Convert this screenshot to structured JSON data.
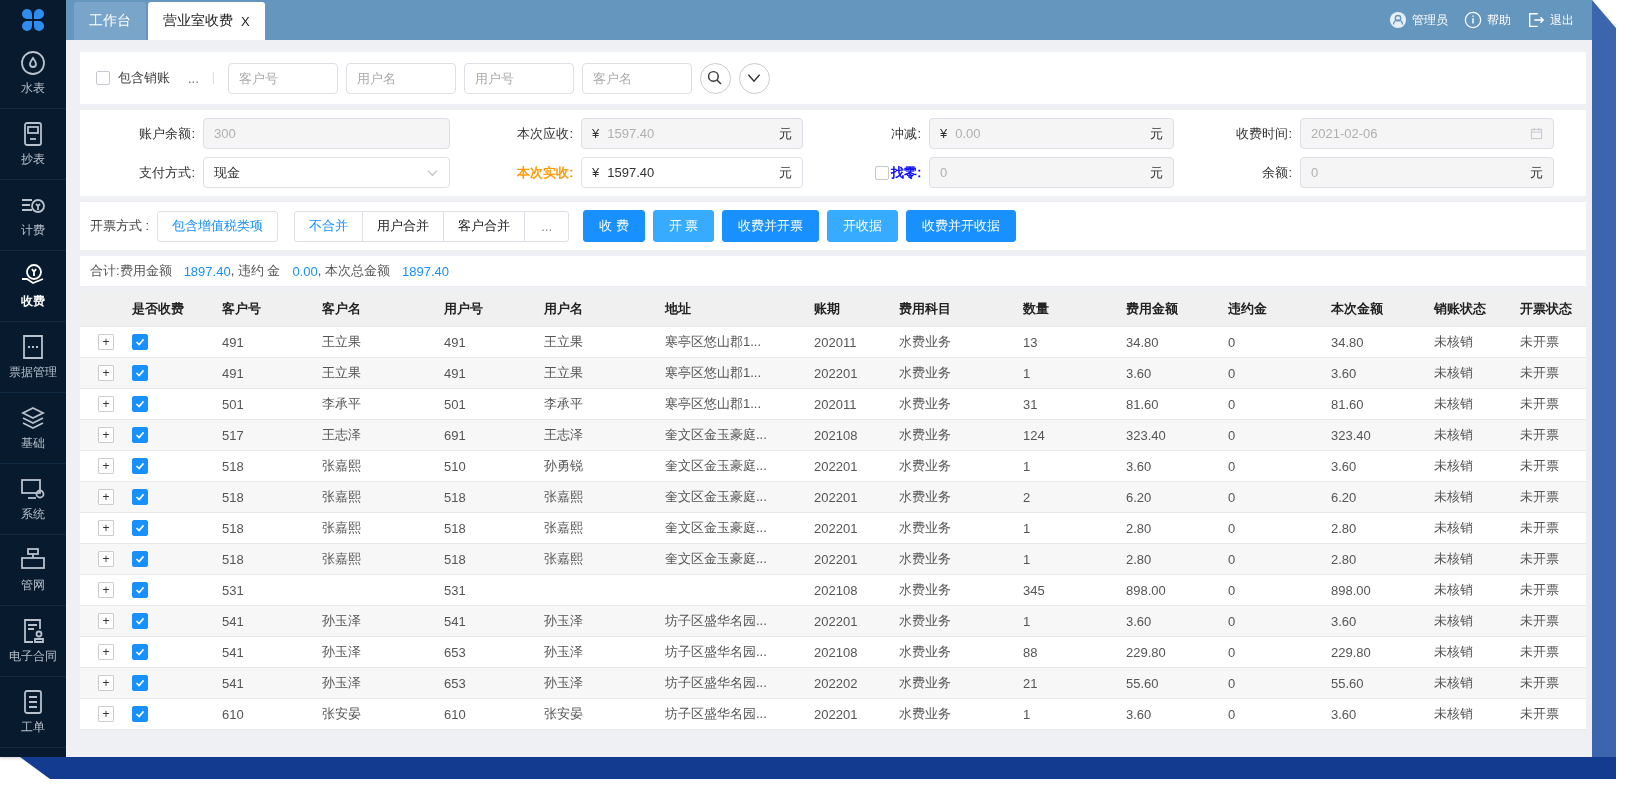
{
  "sidebar": {
    "items": [
      {
        "label": "水表",
        "selected": false
      },
      {
        "label": "抄表",
        "selected": false
      },
      {
        "label": "计费",
        "selected": false
      },
      {
        "label": "收费",
        "selected": true
      },
      {
        "label": "票据管理",
        "selected": false
      },
      {
        "label": "基础",
        "selected": false
      },
      {
        "label": "系统",
        "selected": false
      },
      {
        "label": "管网",
        "selected": false
      },
      {
        "label": "电子合同",
        "selected": false
      },
      {
        "label": "工单",
        "selected": false
      }
    ]
  },
  "tabs": [
    {
      "label": "工作台",
      "selected": false
    },
    {
      "label": "营业室收费",
      "selected": true,
      "close": "X"
    }
  ],
  "header_actions": [
    {
      "label": "管理员"
    },
    {
      "label": "帮助"
    },
    {
      "label": "退出"
    }
  ],
  "filter": {
    "include_writeoff": {
      "label": "包含销账",
      "checked": false
    },
    "more": "...",
    "fields": [
      {
        "placeholder": "客户号"
      },
      {
        "placeholder": "用户名"
      },
      {
        "placeholder": "用户号"
      },
      {
        "placeholder": "客户名"
      }
    ]
  },
  "form": [
    {
      "label": "账户余额:",
      "value": "300",
      "kind": "input",
      "disabled": true
    },
    {
      "label": "本次应收:",
      "value": "1597.40",
      "prefix": "¥",
      "suffix": "元",
      "kind": "input",
      "disabled": true
    },
    {
      "label": "冲减:",
      "value": "0.00",
      "prefix": "¥",
      "suffix": "元",
      "kind": "input",
      "disabled": true
    },
    {
      "label": "收费时间:",
      "value": "2021-02-06",
      "kind": "date",
      "disabled": true
    },
    {
      "label": "支付方式:",
      "value": "现金",
      "kind": "select",
      "disabled": false
    },
    {
      "label": "本次实收:",
      "value": "1597.40",
      "prefix": "¥",
      "suffix": "元",
      "kind": "input",
      "disabled": false,
      "color": "#ff9900"
    },
    {
      "label": "找零:",
      "value": "0",
      "suffix": "元",
      "kind": "input",
      "disabled": true,
      "color": "#0000ff",
      "checkbox": {
        "checked": false
      }
    },
    {
      "label": "余额:",
      "value": "0",
      "suffix": "元",
      "kind": "input",
      "disabled": true
    }
  ],
  "invoice": {
    "label": "开票方式 :",
    "option": "包含增值税类项",
    "merge": [
      {
        "label": "不合并",
        "selected": true
      },
      {
        "label": "用户合并",
        "selected": false
      },
      {
        "label": "客户合并",
        "selected": false
      },
      {
        "label": "...",
        "selected": false
      }
    ],
    "actions": [
      {
        "label": "收 费",
        "kind": "primary"
      },
      {
        "label": "开 票",
        "kind": "light"
      },
      {
        "label": "收费并开票",
        "kind": "primary"
      },
      {
        "label": "开收据",
        "kind": "light"
      },
      {
        "label": "收费并开收据",
        "kind": "primary"
      }
    ]
  },
  "summary": [
    {
      "label": "合计:费用金额",
      "value": "1897.40"
    },
    {
      "label": ", 违约 金",
      "value": "0.00"
    },
    {
      "label": ", 本次总金额",
      "value": "1897.40"
    }
  ],
  "table": {
    "check_column": "是否收费",
    "columns": [
      "客户号",
      "客户名",
      "用户号",
      "用户名",
      "地址",
      "账期",
      "费用科目",
      "数量",
      "费用金额",
      "违约金",
      "本次金额",
      "销账状态",
      "开票状态"
    ],
    "rows": [
      {
        "checked": true,
        "cells": [
          "491",
          "王立果",
          "491",
          "王立果",
          "寒亭区悠山郡1...",
          "202011",
          "水费业务",
          "13",
          "34.80",
          "0",
          "34.80",
          "未核销",
          "未开票"
        ]
      },
      {
        "checked": true,
        "cells": [
          "491",
          "王立果",
          "491",
          "王立果",
          "寒亭区悠山郡1...",
          "202201",
          "水费业务",
          "1",
          "3.60",
          "0",
          "3.60",
          "未核销",
          "未开票"
        ]
      },
      {
        "checked": true,
        "cells": [
          "501",
          "李承平",
          "501",
          "李承平",
          "寒亭区悠山郡1...",
          "202011",
          "水费业务",
          "31",
          "81.60",
          "0",
          "81.60",
          "未核销",
          "未开票"
        ]
      },
      {
        "checked": true,
        "cells": [
          "517",
          "王志泽",
          "691",
          "王志泽",
          "奎文区金玉豪庭...",
          "202108",
          "水费业务",
          "124",
          "323.40",
          "0",
          "323.40",
          "未核销",
          "未开票"
        ]
      },
      {
        "checked": true,
        "cells": [
          "518",
          "张嘉熙",
          "510",
          "孙勇锐",
          "奎文区金玉豪庭...",
          "202201",
          "水费业务",
          "1",
          "3.60",
          "0",
          "3.60",
          "未核销",
          "未开票"
        ]
      },
      {
        "checked": true,
        "cells": [
          "518",
          "张嘉熙",
          "518",
          "张嘉熙",
          "奎文区金玉豪庭...",
          "202201",
          "水费业务",
          "2",
          "6.20",
          "0",
          "6.20",
          "未核销",
          "未开票"
        ]
      },
      {
        "checked": true,
        "cells": [
          "518",
          "张嘉熙",
          "518",
          "张嘉熙",
          "奎文区金玉豪庭...",
          "202201",
          "水费业务",
          "1",
          "2.80",
          "0",
          "2.80",
          "未核销",
          "未开票"
        ]
      },
      {
        "checked": true,
        "cells": [
          "518",
          "张嘉熙",
          "518",
          "张嘉熙",
          "奎文区金玉豪庭...",
          "202201",
          "水费业务",
          "1",
          "2.80",
          "0",
          "2.80",
          "未核销",
          "未开票"
        ]
      },
      {
        "checked": true,
        "cells": [
          "531",
          "",
          "531",
          "",
          "",
          "202108",
          "水费业务",
          "345",
          "898.00",
          "0",
          "898.00",
          "未核销",
          "未开票"
        ]
      },
      {
        "checked": true,
        "cells": [
          "541",
          "孙玉泽",
          "541",
          "孙玉泽",
          "坊子区盛华名园...",
          "202201",
          "水费业务",
          "1",
          "3.60",
          "0",
          "3.60",
          "未核销",
          "未开票"
        ]
      },
      {
        "checked": true,
        "cells": [
          "541",
          "孙玉泽",
          "653",
          "孙玉泽",
          "坊子区盛华名园...",
          "202108",
          "水费业务",
          "88",
          "229.80",
          "0",
          "229.80",
          "未核销",
          "未开票"
        ]
      },
      {
        "checked": true,
        "cells": [
          "541",
          "孙玉泽",
          "653",
          "孙玉泽",
          "坊子区盛华名园...",
          "202202",
          "水费业务",
          "21",
          "55.60",
          "0",
          "55.60",
          "未核销",
          "未开票"
        ]
      },
      {
        "checked": true,
        "cells": [
          "610",
          "张安晏",
          "610",
          "张安晏",
          "坊子区盛华名园...",
          "202201",
          "水费业务",
          "1",
          "3.60",
          "0",
          "3.60",
          "未核销",
          "未开票"
        ]
      }
    ],
    "expand_symbol": "+"
  }
}
